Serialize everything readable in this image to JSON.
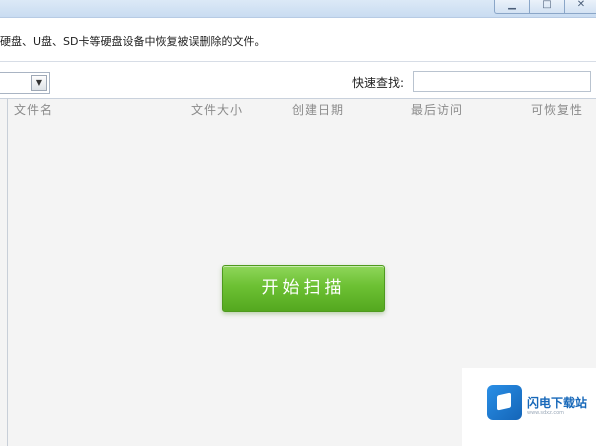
{
  "window": {
    "minimize_glyph": "▁",
    "maximize_glyph": "□",
    "close_glyph": "✕"
  },
  "description": "硬盘、U盘、SD卡等硬盘设备中恢复被误删除的文件。",
  "toolbar": {
    "drive_select_value": "",
    "search_label": "快速查找:",
    "search_placeholder": "",
    "search_value": ""
  },
  "file_list": {
    "columns": [
      "文件名",
      "文件大小",
      "创建日期",
      "最后访问",
      "可恢复性"
    ],
    "rows": []
  },
  "scan_button_label": "开始扫描",
  "watermark": {
    "logo_text": "闪电下载站",
    "sub_text": "www.sdxz.com"
  },
  "colors": {
    "accent_green": "#6cc033",
    "title_bar": "#c9dcf1",
    "list_background": "#f4f4f4"
  }
}
